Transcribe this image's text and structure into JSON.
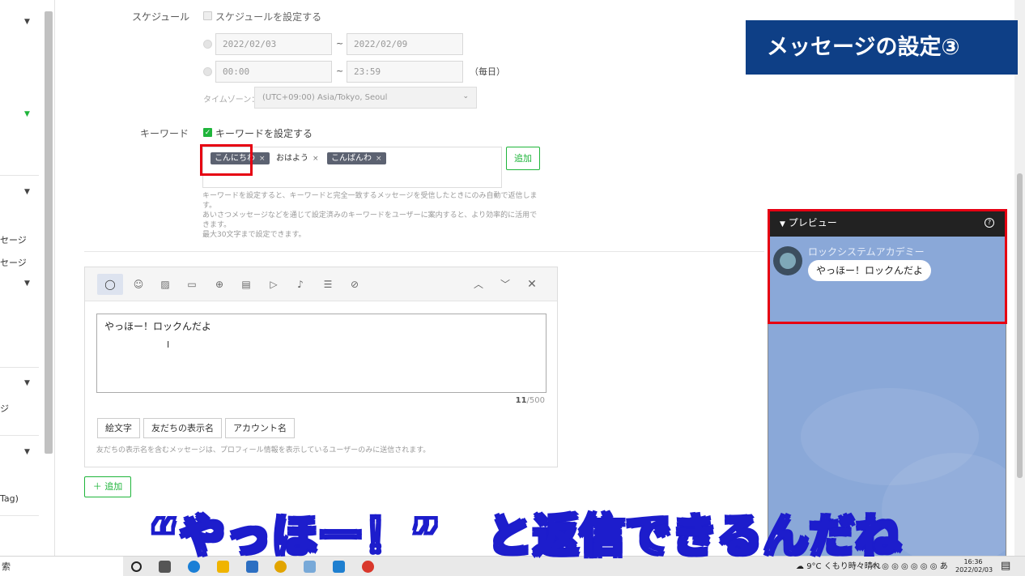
{
  "sidebar": {
    "labels": [
      "セージ",
      "セージ",
      "ジ",
      "Tag)"
    ]
  },
  "form": {
    "schedule_label": "スケジュール",
    "schedule_checkbox": "スケジュールを設定する",
    "start_date": "2022/02/03",
    "end_date": "2022/02/09",
    "start_time": "00:00",
    "end_time": "23:59",
    "tilde": "~",
    "daily": "（毎日）",
    "timezone_label": "タイムゾーン：",
    "timezone_value": "(UTC+09:00) Asia/Tokyo, Seoul",
    "keyword_label": "キーワード",
    "keyword_checkbox": "キーワードを設定する",
    "keywords": [
      "こんにちわ",
      "おはよう",
      "こんばんわ"
    ],
    "add_keyword": "追加",
    "hint_lines": [
      "キーワードを設定すると、キーワードと完全一致するメッセージを受信したときにのみ自動で返信します。",
      "あいさつメッセージなどを通じて設定済みのキーワードをユーザーに案内すると、より効率的に活用できます。",
      "最大30文字まで設定できます。"
    ]
  },
  "editor": {
    "message": "やっほー！ロックんだよ",
    "count": "11",
    "max": "/500",
    "buttons": [
      "絵文字",
      "友だちの表示名",
      "アカウント名"
    ],
    "note": "友だちの表示名を含むメッセージは、プロフィール情報を表示しているユーザーのみに送信されます。",
    "add_button": "＋ 追加"
  },
  "preview": {
    "title": "プレビュー",
    "account_name": "ロックシステムアカデミー",
    "bubble": "やっほー！ロックんだよ"
  },
  "banner": "メッセージの設定③",
  "caption": "“やっほー！”　と返信できるんだね",
  "taskbar": {
    "search": "索",
    "weather": "9°C  くもり時々晴れ",
    "tray": "へ  ◎  ◎  ◎  ◎  ◎  ◎  あ",
    "time": "16:36",
    "date": "2022/02/03"
  },
  "colors": {
    "accent_green": "#1fb53b",
    "highlight_red": "#e60012",
    "banner_blue": "#0e3f86",
    "preview_bg": "#8aa8d8"
  }
}
